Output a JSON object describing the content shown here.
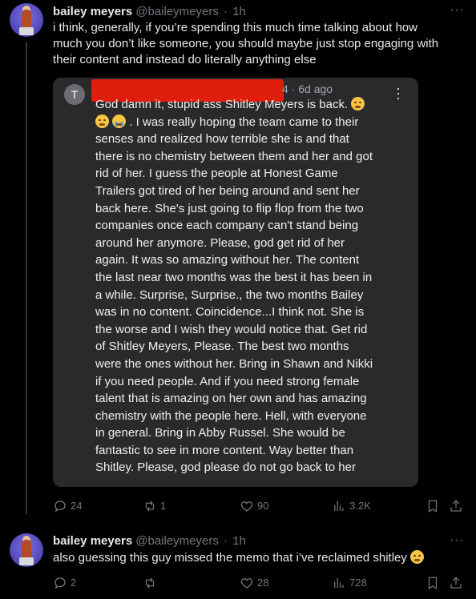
{
  "tweets": [
    {
      "author_name": "bailey meyers",
      "handle": "@baileymeyers",
      "separator": "·",
      "time": "1h",
      "more_icon": "more-horizontal-icon",
      "text_lines": [
        "i think, generally, if you’re spending this much time talking about how",
        "much you don’t like someone, you should maybe just stop engaging with",
        "their content and instead do literally anything else"
      ],
      "stats": {
        "replies": "24",
        "reposts": "1",
        "likes": "90",
        "views": "3.2K"
      }
    },
    {
      "author_name": "bailey meyers",
      "handle": "@baileymeyers",
      "separator": "·",
      "time": "1h",
      "more_icon": "more-horizontal-icon",
      "text": "also guessing this guy missed the memo that i’ve reclaimed shitley",
      "text_emoji": "relieved-face-emoji",
      "stats": {
        "replies": "2",
        "reposts": "",
        "likes": "28",
        "views": "728"
      }
    }
  ],
  "quoted_comment": {
    "avatar_letter": "T",
    "meta_fragment": "4 · 6d ago",
    "line1": "God damn it, stupid ass Shitley Meyers is back.",
    "line1_emoji": "steam-from-nose-emoji",
    "line2_emojis": [
      "weary-face-emoji",
      "loudly-crying-face-emoji"
    ],
    "line2": " . I was really hoping the team came to their",
    "lines": [
      "senses and realized how terrible she is and that",
      "there is no chemistry between them and her and got",
      "rid of her. I guess the people at Honest Game",
      "Trailers got tired of her being around and sent her",
      "back here. She's just going to flip flop from the two",
      "companies once each company can't stand being",
      "around her anymore. Please, god get rid of her",
      "again. It was so amazing without her. The content",
      "the last near two months was the best it has been in",
      "a while. Surprise, Surprise., the two months Bailey",
      "was in no content. Coincidence...I think not. She is",
      "the worse and I wish they would notice that. Get rid",
      "of Shitley Meyers, Please. The best two months",
      "were the ones without her. Bring in Shawn and Nikki",
      "if you need people. And if you need strong female",
      "talent that is amazing on her own and has amazing",
      "chemistry with the people here. Hell, with everyone",
      "in general. Bring in Abby Russel. She would be",
      "fantastic to see in more content. Way better than",
      "Shitley. Please, god please do not go back to her"
    ],
    "more_icon": "more-vertical-icon",
    "redaction_color": "#e01e0e"
  },
  "colors": {
    "background": "#000000",
    "text_primary": "#e7e9ea",
    "text_secondary": "#71767b",
    "quote_background": "#2a2a2c"
  }
}
